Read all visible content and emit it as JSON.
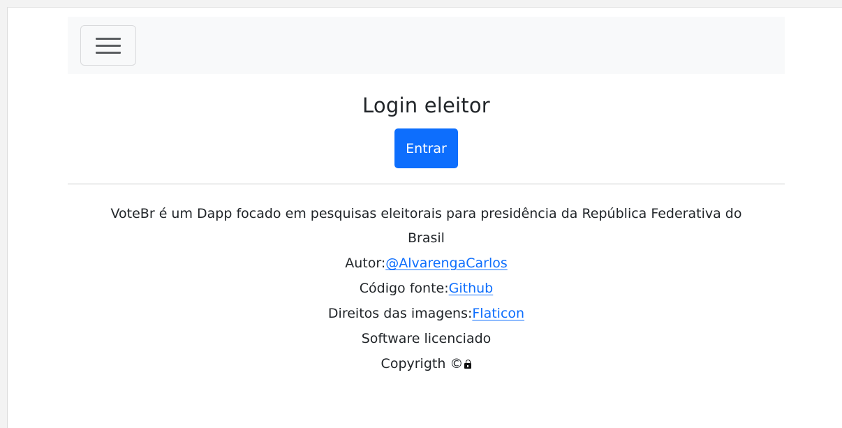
{
  "navbar": {
    "toggler_icon": "hamburger-menu-icon"
  },
  "main": {
    "title": "Login eleitor",
    "enter_button": "Entrar"
  },
  "footer": {
    "description": "VoteBr é um Dapp focado em pesquisas eleitorais para presidência da República Federativa do Brasil",
    "author_label": "Autor:",
    "author_link": "@AlvarengaCarlos",
    "source_label": "Código fonte:",
    "source_link": "Github",
    "images_label": "Direitos das imagens:",
    "images_link": "Flaticon",
    "license": "Software licenciado",
    "copyright": "Copyrigth ©",
    "copyright_icon": "lock-icon"
  },
  "colors": {
    "primary": "#0d6efd",
    "navbar_bg": "#f8f9fa",
    "text": "#212529"
  }
}
